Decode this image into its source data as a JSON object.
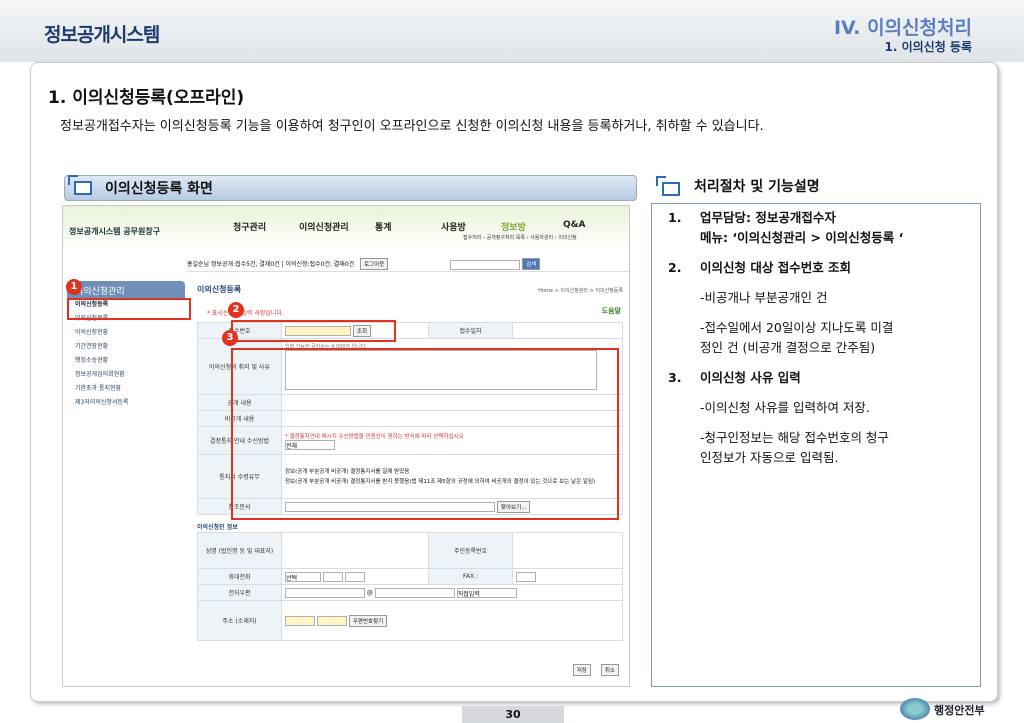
{
  "header": {
    "logo": "정보공개시스템",
    "chapter": "IV. 이의신청처리",
    "subchapter": "1. 이의신청 등록"
  },
  "title": "1. 이의신청등록(오프라인)",
  "description": "정보공개접수자는 이의신청등록 기능을 이용하여 청구인이 오프라인으로 신청한 이의신청 내용을 등록하거나, 취하할 수 있습니다.",
  "left_section": {
    "heading": "이의신청등록 화면"
  },
  "right_section": {
    "heading": "처리절차 및 기능설명",
    "lines": [
      "1.",
      "업무담당: 정보공개접수자",
      "메뉴: ‘이의신청관리 > 이의신청등록 ‘",
      "2.",
      "이의신청 대상 접수번호 조회",
      "-비공개나 부분공개인 건",
      "-접수일에서 20일이상 지나도록 미결",
      "정인 건 (비공개 결정으로 간주됨)",
      "3.",
      "이의신청 사유 입력",
      "-이의신청 사유를 입력하여 저장.",
      "-청구인정보는 해당 접수번호의 청구",
      "인정보가 자동으로 입력됨."
    ]
  },
  "screenshot": {
    "brand": "정보공개시스템 공무원창구",
    "nav": [
      "청구관리",
      "이의신청관리",
      "통계",
      "사용방",
      "정보방",
      "Q&A"
    ],
    "nav_sub": "접수처리 › 공개청구처리 목록 › 사용자관리 › 이의신청",
    "user_bar": "홍길순님    정보공개:접수5건, 결재0건 | 이의신청:접수0건, 결재0건",
    "logout": "로그아웃",
    "search": "검색",
    "side_header": "이의신청관리",
    "side_items": [
      "이의신청등록",
      "이의신청목록",
      "이의신청현황",
      "기간연장현황",
      "행정소송현황",
      "정보공개심의회현황",
      "기한초과 통지현황",
      "제3자이의신청서등록"
    ],
    "main_title": "이의신청등록",
    "crumb": "Home > 이의신청관리 > 이의신청등록",
    "required": "* 표시는 필수입력 사항입니다.",
    "help": "도움말",
    "receipt_no": "접수번호",
    "lookup": "조회",
    "receipt_date": "접수일자",
    "hint": "입력 가능한 글자수는 4,000자 입니다.",
    "reason": "이의신청의 취지 및 사유",
    "open_content": "공개 내용",
    "nonopen_content": "비공개 내용",
    "notify_method": "결정통지 안내 수신방법",
    "notify_note": "* 결정통지안내 메시지 수신방법을 민원인이 원하는 방식에 따라 선택하십시오",
    "notify_select": "전체",
    "notice_receipt": "통지서 수령유무",
    "opt1": "정보(공개 부분공개 비공개) 결정통지서를  일에 받았음",
    "opt2": "정보(공개 부분공개 비공개) 결정통지서를 받지 못했음(법 제11조 제5항의 규정에 의하여 비공개의 결정이 있는 것으로 보는 날은  일임)",
    "attach": "참조문서",
    "browse": "찾아보기...",
    "applicant_info": "이의신청인 정보",
    "name": "성명 (법인명 등 및 대표자)",
    "resident_no": "주민등록번호",
    "phone": "전화번호 (모사전송번호)",
    "mobile": "휴대전화",
    "mobile_select": "선택",
    "fax": "FAX :",
    "email": "전자우편",
    "at": "@",
    "email_select": "직접입력",
    "address": "주소 (소재지)",
    "zip_btn": "우편번호찾기",
    "save": "저장",
    "cancel": "취소"
  },
  "markers": [
    "1",
    "2",
    "3"
  ],
  "page_number": "30",
  "footer_org": "행정안전부"
}
